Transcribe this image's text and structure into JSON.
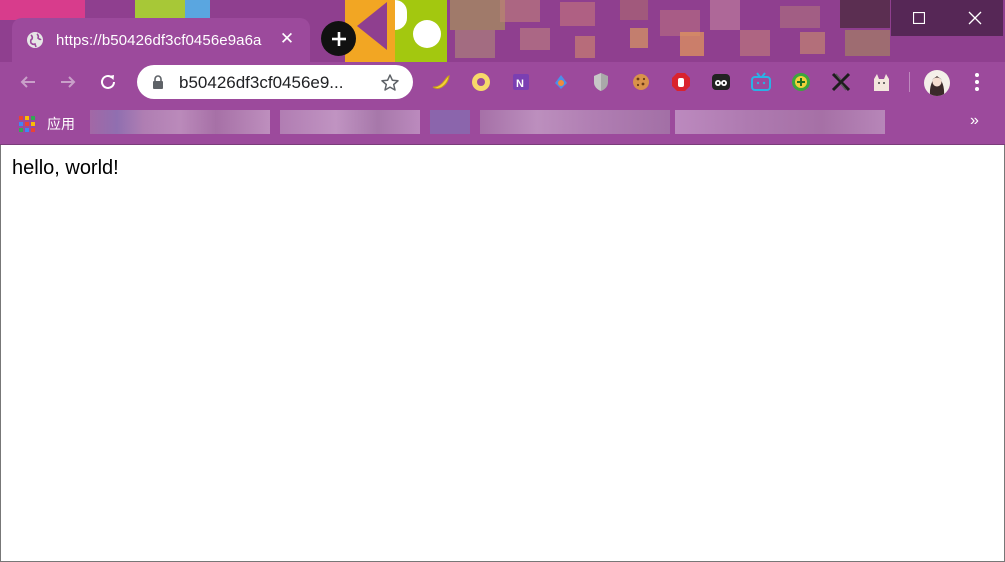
{
  "tab": {
    "title": "https://b50426df3cf0456e9a6a",
    "close_label": "✕"
  },
  "window": {
    "maximize_label": "☐",
    "close_label": "✕"
  },
  "omnibox": {
    "url": "b50426df3cf0456e9..."
  },
  "extensions": [
    "banana-icon",
    "donut-icon",
    "onenote-icon",
    "fox-icon",
    "shield-icon",
    "cookie-icon",
    "adblock-hand-icon",
    "eyes-icon",
    "bilibili-tv-icon",
    "plus-circle-icon",
    "x-logo-icon",
    "cat-icon"
  ],
  "bookmarks": {
    "apps_label": "应用",
    "overflow_label": "»"
  },
  "page": {
    "body_text": "hello, world!"
  },
  "colors": {
    "frame": "#9c4a9c",
    "frame_dark": "#8f3f8f",
    "content_bg": "#ffffff"
  }
}
